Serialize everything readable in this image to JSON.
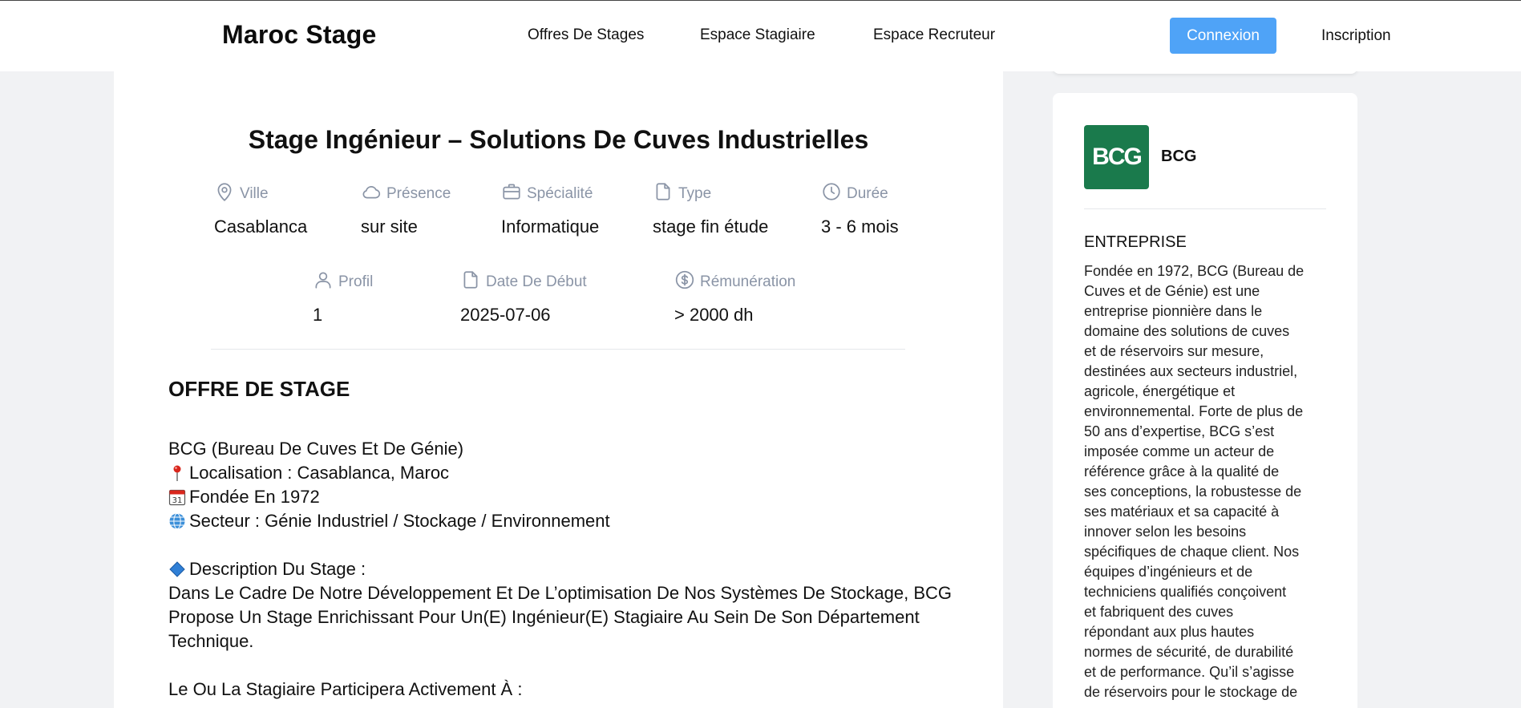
{
  "header": {
    "logo": "Maroc Stage",
    "nav": [
      {
        "label": "Offres De Stages"
      },
      {
        "label": "Espace Stagiaire"
      },
      {
        "label": "Espace Recruteur"
      }
    ],
    "login_label": "Connexion",
    "register_label": "Inscription",
    "accent_color": "#4fa3f7"
  },
  "offer": {
    "title": "Stage Ingénieur – Solutions De Cuves Industrielles",
    "meta_row1": [
      {
        "icon": "location-pin-icon",
        "label": "Ville",
        "value": "Casablanca"
      },
      {
        "icon": "cloud-icon",
        "label": "Présence",
        "value": "sur site"
      },
      {
        "icon": "briefcase-icon",
        "label": "Spécialité",
        "value": "Informatique"
      },
      {
        "icon": "document-icon",
        "label": "Type",
        "value": "stage fin étude"
      },
      {
        "icon": "clock-icon",
        "label": "Durée",
        "value": "3 - 6 mois"
      }
    ],
    "meta_row2": [
      {
        "icon": "user-icon",
        "label": "Profil",
        "value": "1"
      },
      {
        "icon": "document-icon",
        "label": "Date De Début",
        "value": "2025-07-06"
      },
      {
        "icon": "dollar-circle-icon",
        "label": "Rémunération",
        "value": "> 2000 dh"
      }
    ],
    "section_title": "OFFRE DE STAGE",
    "description": {
      "company_line": "BCG (Bureau De Cuves Et De Génie)",
      "location_line": "Localisation : Casablanca, Maroc",
      "founded_line": "Fondée En 1972",
      "sector_line": "Secteur : Génie Industriel / Stockage / Environnement",
      "stage_heading": "Description Du Stage :",
      "paragraph_1": "Dans Le Cadre De Notre Développement Et De L’optimisation De Nos Systèmes De Stockage, BCG",
      "paragraph_2": "Propose Un Stage Enrichissant Pour Un(E) Ingénieur(E) Stagiaire Au Sein De Son Département",
      "paragraph_3": "Technique.",
      "tasks_heading": "Le Ou La Stagiaire Participera Activement À :"
    }
  },
  "company": {
    "logo_text": "BCG",
    "logo_color": "#1a7a4c",
    "name": "BCG",
    "heading": "ENTREPRISE",
    "about_lines": [
      "Fondée en 1972, BCG (Bureau de",
      "Cuves et de Génie) est une",
      "entreprise pionnière dans le",
      "domaine des solutions de cuves",
      "et de réservoirs sur mesure,",
      "destinées aux secteurs industriel,",
      "agricole, énergétique et",
      "environnemental. Forte de plus de",
      "50 ans d’expertise, BCG s’est",
      "imposée comme un acteur de",
      "référence grâce à la qualité de",
      "ses conceptions, la robustesse de",
      "ses matériaux et sa capacité à",
      "innover selon les besoins",
      "spécifiques de chaque client. Nos",
      "équipes d’ingénieurs et de",
      "techniciens qualifiés conçoivent",
      "et fabriquent des cuves",
      "répondant aux plus hautes",
      "normes de sécurité, de durabilité",
      "et de performance. Qu’il s’agisse",
      "de réservoirs pour le stockage de"
    ]
  }
}
